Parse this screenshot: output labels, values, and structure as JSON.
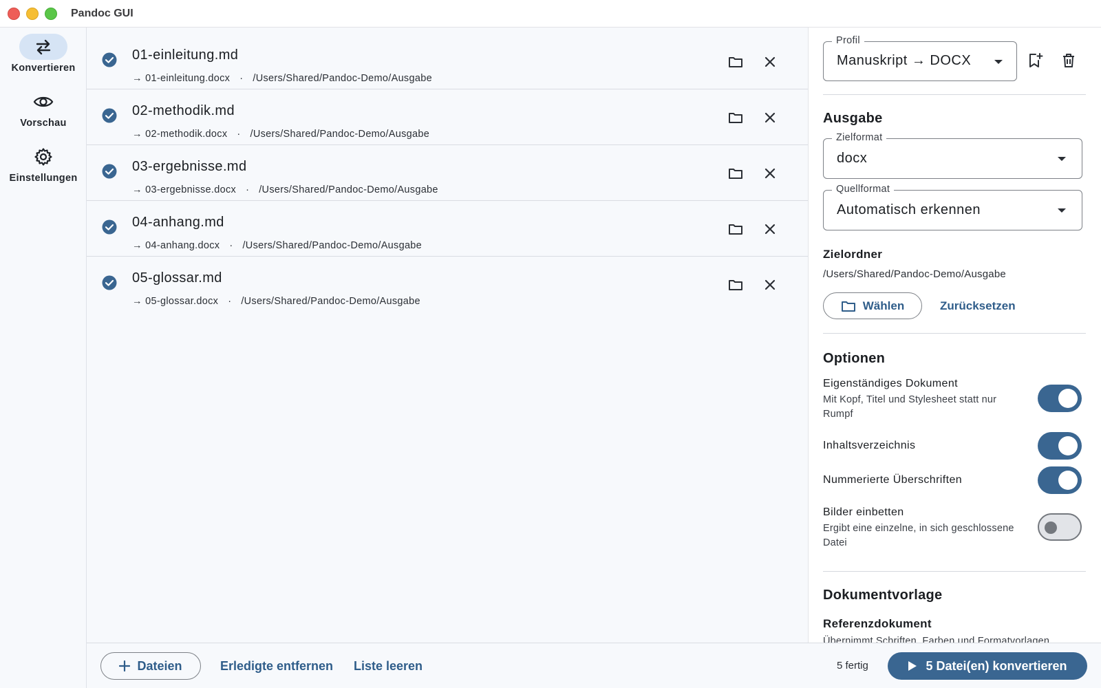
{
  "window": {
    "title": "Pandoc GUI"
  },
  "rail": {
    "items": [
      {
        "label": "Konvertieren",
        "icon": "swap-arrows-icon"
      },
      {
        "label": "Vorschau",
        "icon": "eye-icon"
      },
      {
        "label": "Einstellungen",
        "icon": "gear-icon"
      }
    ]
  },
  "files": [
    {
      "name": "01-einleitung.md",
      "output": "→ 01-einleitung.docx",
      "sep": "·",
      "path": "/Users/Shared/Pandoc-Demo/Ausgabe"
    },
    {
      "name": "02-methodik.md",
      "output": "→ 02-methodik.docx",
      "sep": "·",
      "path": "/Users/Shared/Pandoc-Demo/Ausgabe"
    },
    {
      "name": "03-ergebnisse.md",
      "output": "→ 03-ergebnisse.docx",
      "sep": "·",
      "path": "/Users/Shared/Pandoc-Demo/Ausgabe"
    },
    {
      "name": "04-anhang.md",
      "output": "→ 04-anhang.docx",
      "sep": "·",
      "path": "/Users/Shared/Pandoc-Demo/Ausgabe"
    },
    {
      "name": "05-glossar.md",
      "output": "→ 05-glossar.docx",
      "sep": "·",
      "path": "/Users/Shared/Pandoc-Demo/Ausgabe"
    }
  ],
  "bottom": {
    "add_label": "Dateien",
    "remove_done_label": "Erledigte entfernen",
    "clear_label": "Liste leeren",
    "status": "5 fertig",
    "convert_label": "5 Datei(en) konvertieren"
  },
  "panel": {
    "profile": {
      "legend": "Profil",
      "value": "Manuskript → DOCX"
    },
    "output_section": "Ausgabe",
    "target_format": {
      "legend": "Zielformat",
      "value": "docx"
    },
    "source_format": {
      "legend": "Quellformat",
      "value": "Automatisch erkennen"
    },
    "target_folder": {
      "title": "Zielordner",
      "path": "/Users/Shared/Pandoc-Demo/Ausgabe",
      "choose_label": "Wählen",
      "reset_label": "Zurücksetzen"
    },
    "options_section": "Optionen",
    "options": {
      "standalone": {
        "label": "Eigenständiges Dokument",
        "desc": "Mit Kopf, Titel und Stylesheet statt nur Rumpf",
        "on": true
      },
      "toc": {
        "label": "Inhaltsverzeichnis",
        "on": true
      },
      "numbered": {
        "label": "Nummerierte Überschriften",
        "on": true
      },
      "embed": {
        "label": "Bilder einbetten",
        "desc": "Ergibt eine einzelne, in sich geschlossene Datei",
        "on": false
      }
    },
    "template_section": "Dokumentvorlage",
    "reference": {
      "title": "Referenzdokument",
      "desc": "Übernimmt Schriften, Farben und Formatvorlagen"
    }
  },
  "colors": {
    "accent": "#3a6691",
    "link": "#2f5d8a",
    "rail_active": "#d6e4f5",
    "background": "#f7f9fc"
  }
}
